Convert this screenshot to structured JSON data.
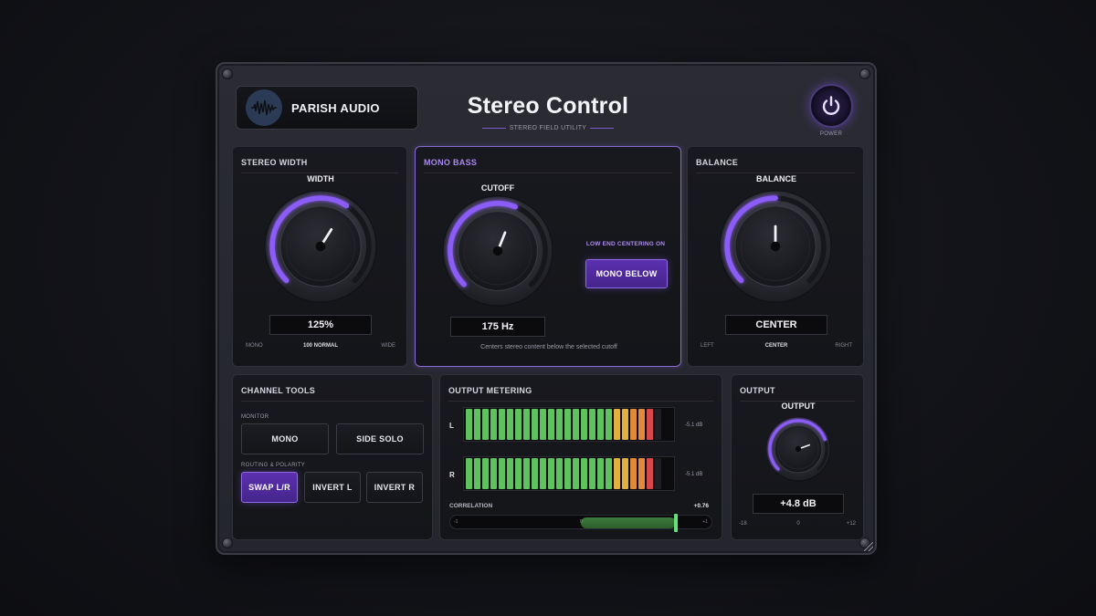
{
  "header": {
    "brand": "PARISH AUDIO",
    "title": "Stereo Control",
    "subtitle": "STEREO FIELD UTILITY",
    "power_label": "POWER"
  },
  "stereo_width": {
    "panel_title": "STEREO WIDTH",
    "knob_label": "WIDTH",
    "value": "125%",
    "level": 0.62,
    "scale_min": "MONO",
    "scale_mid": "100 NORMAL",
    "scale_max": "WIDE"
  },
  "mono_bass": {
    "panel_title": "MONO BASS",
    "knob_label": "CUTOFF",
    "value": "175 Hz",
    "level": 0.58,
    "centering_label": "LOW END CENTERING ON",
    "button_label": "MONO BELOW",
    "hint": "Centers stereo content below the selected cutoff"
  },
  "balance": {
    "panel_title": "BALANCE",
    "knob_label": "BALANCE",
    "value": "CENTER",
    "level": 0.5,
    "scale_min": "LEFT",
    "scale_mid": "CENTER",
    "scale_max": "RIGHT"
  },
  "channel_tools": {
    "panel_title": "CHANNEL TOOLS",
    "monitor_label": "MONITOR",
    "mono_label": "MONO",
    "side_solo_label": "SIDE SOLO",
    "routing_label": "ROUTING & POLARITY",
    "swap_label": "SWAP L/R",
    "invert_l_label": "INVERT L",
    "invert_r_label": "INVERT R"
  },
  "output_metering": {
    "panel_title": "OUTPUT METERING",
    "left_label": "L",
    "right_label": "R",
    "left_db": "-5.1 dB",
    "right_db": "-5.1 dB",
    "segments_total": 24,
    "segments_lit": 23,
    "correlation_label": "CORRELATION",
    "correlation_value": "+0.76",
    "correlation": 0.76,
    "corr_min": "-1",
    "corr_mid": "0",
    "corr_max": "+1",
    "colors": {
      "green": "#5ec25e",
      "yellow": "#e0b040",
      "orange": "#e08a3a",
      "red": "#d94848",
      "off": "#1e1f24"
    }
  },
  "output": {
    "panel_title": "OUTPUT",
    "knob_label": "OUTPUT",
    "value": "+4.8 dB",
    "level": 0.76,
    "scale_min": "-18",
    "scale_mid": "0",
    "scale_max": "+12"
  },
  "colors": {
    "accent": "#8b5cf6",
    "accent_glow": "#a07cff"
  }
}
